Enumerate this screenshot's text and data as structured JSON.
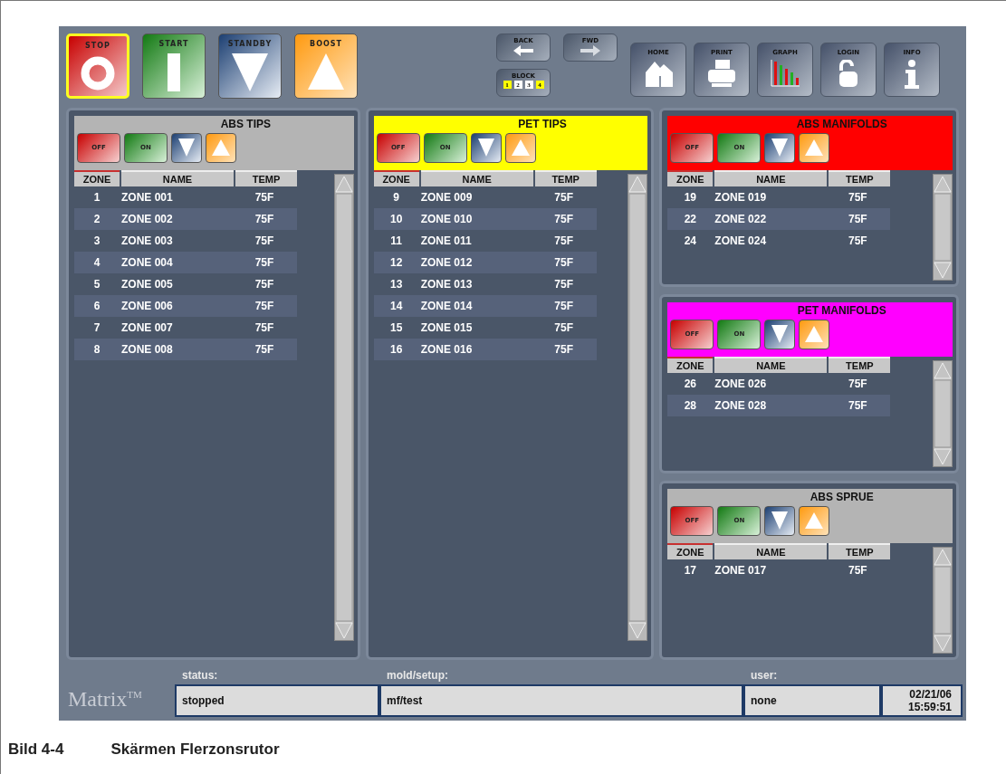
{
  "mode_buttons": [
    {
      "label": "STOP",
      "kind": "stop",
      "selected": true
    },
    {
      "label": "START",
      "kind": "start",
      "selected": false
    },
    {
      "label": "STANDBY",
      "kind": "standby",
      "selected": false
    },
    {
      "label": "BOOST",
      "kind": "boost",
      "selected": false
    }
  ],
  "nav_buttons": [
    {
      "label": "BACK",
      "kind": "back"
    },
    {
      "label": "FWD",
      "kind": "fwd"
    }
  ],
  "block": {
    "label": "BLOCK",
    "items": [
      {
        "label": "1",
        "selected": true
      },
      {
        "label": "2",
        "selected": false
      },
      {
        "label": "3",
        "selected": false
      },
      {
        "label": "4",
        "selected": true
      }
    ]
  },
  "tool_buttons": [
    {
      "label": "HOME",
      "kind": "home"
    },
    {
      "label": "PRINT",
      "kind": "print"
    },
    {
      "label": "GRAPH",
      "kind": "graph"
    },
    {
      "label": "LOGIN",
      "kind": "login"
    },
    {
      "label": "INFO",
      "kind": "info"
    }
  ],
  "panel_columns": [
    {
      "panels": [
        {
          "title": "ABS TIPS",
          "color": "#b4b4b4",
          "buttons": [
            "OFF",
            "ON"
          ],
          "columns": [
            "ZONE",
            "NAME",
            "TEMP"
          ],
          "rows": [
            [
              "1",
              "ZONE 001",
              "75F"
            ],
            [
              "2",
              "ZONE 002",
              "75F"
            ],
            [
              "3",
              "ZONE 003",
              "75F"
            ],
            [
              "4",
              "ZONE 004",
              "75F"
            ],
            [
              "5",
              "ZONE 005",
              "75F"
            ],
            [
              "6",
              "ZONE 006",
              "75F"
            ],
            [
              "7",
              "ZONE 007",
              "75F"
            ],
            [
              "8",
              "ZONE 008",
              "75F"
            ]
          ]
        }
      ]
    },
    {
      "panels": [
        {
          "title": "PET TIPS",
          "color": "#ffff00",
          "buttons": [
            "OFF",
            "ON"
          ],
          "columns": [
            "ZONE",
            "NAME",
            "TEMP"
          ],
          "rows": [
            [
              "9",
              "ZONE 009",
              "75F"
            ],
            [
              "10",
              "ZONE 010",
              "75F"
            ],
            [
              "11",
              "ZONE 011",
              "75F"
            ],
            [
              "12",
              "ZONE 012",
              "75F"
            ],
            [
              "13",
              "ZONE 013",
              "75F"
            ],
            [
              "14",
              "ZONE 014",
              "75F"
            ],
            [
              "15",
              "ZONE 015",
              "75F"
            ],
            [
              "16",
              "ZONE 016",
              "75F"
            ]
          ]
        }
      ]
    },
    {
      "panels": [
        {
          "title": "ABS MANIFOLDS",
          "color": "#ff0000",
          "buttons": [
            "OFF",
            "ON"
          ],
          "columns": [
            "ZONE",
            "NAME",
            "TEMP"
          ],
          "rows": [
            [
              "19",
              "ZONE 019",
              "75F"
            ],
            [
              "22",
              "ZONE 022",
              "75F"
            ],
            [
              "24",
              "ZONE 024",
              "75F"
            ]
          ]
        },
        {
          "title": "PET MANIFOLDS",
          "color": "#ff00ff",
          "buttons": [
            "OFF",
            "ON"
          ],
          "columns": [
            "ZONE",
            "NAME",
            "TEMP"
          ],
          "rows": [
            [
              "26",
              "ZONE 026",
              "75F"
            ],
            [
              "28",
              "ZONE 028",
              "75F"
            ]
          ]
        },
        {
          "title": "ABS SPRUE",
          "color": "#b4b4b4",
          "buttons": [
            "OFF",
            "ON"
          ],
          "columns": [
            "ZONE",
            "NAME",
            "TEMP"
          ],
          "rows": [
            [
              "17",
              "ZONE 017",
              "75F"
            ]
          ]
        }
      ]
    }
  ],
  "status_bar": {
    "logo": "Matrix",
    "logo_mark": "TM",
    "fields": [
      {
        "label": "status:",
        "value": "stopped"
      },
      {
        "label": "mold/setup:",
        "value": "mf/test"
      },
      {
        "label": "user:",
        "value": "none"
      }
    ],
    "date": "02/21/06",
    "time": "15:59:51"
  },
  "caption": {
    "number": "Bild 4-4",
    "text": "Skärmen Flerzonsrutor"
  }
}
